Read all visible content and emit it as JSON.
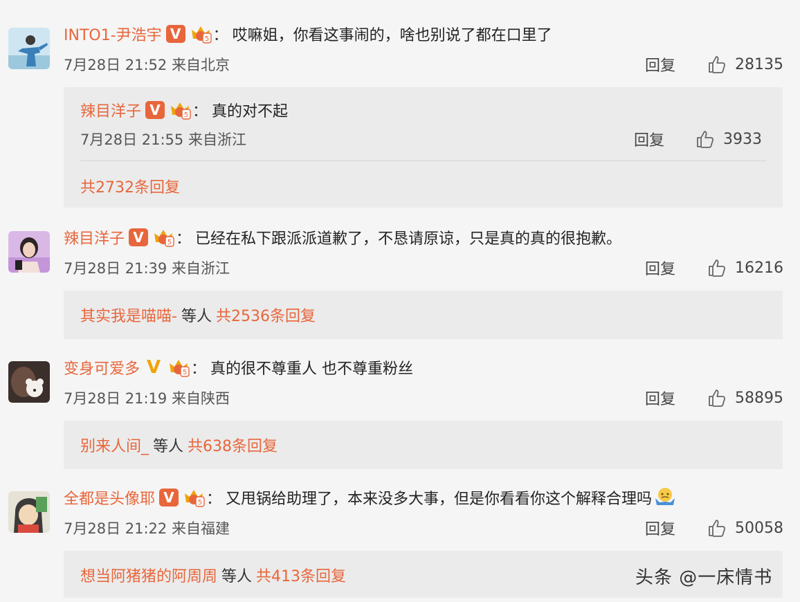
{
  "comments": [
    {
      "username": "INTO1-尹浩宇",
      "text": "哎嘛姐，你看这事闹的，啥也别说了都在口里了",
      "time": "7月28日 21:52 来自北京",
      "reply_label": "回复",
      "likes": "28135",
      "verified_badge": "V",
      "nested_reply": {
        "username": "辣目洋子",
        "text": "真的对不起",
        "time": "7月28日 21:55 来自浙江",
        "reply_label": "回复",
        "likes": "3933",
        "verified_badge": "V"
      },
      "reply_summary": {
        "total": "共2732条回复"
      }
    },
    {
      "username": "辣目洋子",
      "text": "已经在私下跟派派道歉了，不恳请原谅，只是真的真的很抱歉。",
      "time": "7月28日 21:39 来自浙江",
      "reply_label": "回复",
      "likes": "16216",
      "verified_badge": "V",
      "reply_summary": {
        "replier": "其实我是喵喵-",
        "others": "等人",
        "total": "共2536条回复"
      }
    },
    {
      "username": "变身可爱多",
      "text": "真的很不尊重人 也不尊重粉丝",
      "time": "7月28日 21:19 来自陕西",
      "reply_label": "回复",
      "likes": "58895",
      "verified_badge": "V",
      "reply_summary": {
        "replier": "别来人间_",
        "others": "等人",
        "total": "共638条回复"
      }
    },
    {
      "username": "全都是头像耶",
      "text": "又甩锅给助理了，本来没多大事，但是你看看你这个解释合理吗",
      "time": "7月28日 21:22 来自福建",
      "reply_label": "回复",
      "likes": "50058",
      "verified_badge": "V",
      "emoji_icon": "shrug-emoji-icon",
      "reply_summary": {
        "replier": "想当阿猪猪的阿周周",
        "others": "等人",
        "total": "共413条回复"
      }
    }
  ],
  "watermark": "头条 @一床情书",
  "colors": {
    "username": "#e8663b",
    "verified_red": "#e8663b",
    "verified_gold": "#f0a40a",
    "background": "#f5f5f5",
    "reply_box": "#ebebeb"
  }
}
